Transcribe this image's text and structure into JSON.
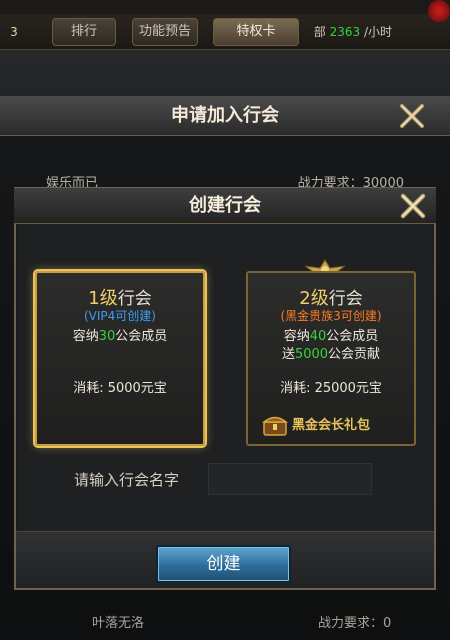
{
  "topbar": {
    "left_badge": "3",
    "tabs": [
      "排行",
      "功能预告",
      "特权卡"
    ],
    "rate_prefix": "部",
    "rate_value": "2363",
    "rate_suffix": "/小时"
  },
  "back_panel": {
    "title": "申请加入行会",
    "rows": [
      {
        "name": "娱乐而已",
        "req_label": "战力要求：",
        "req_value": "30000"
      }
    ],
    "bottom_row": {
      "name": "叶落无洛",
      "req_label": "战力要求：",
      "req_value": "0"
    }
  },
  "dialog": {
    "title": "创建行会",
    "cards": [
      {
        "level": "1级",
        "label": "行会",
        "sub": "(VIP4可创建)",
        "sub_color": "#3a9cf2",
        "capacity_prefix": "容纳",
        "capacity_value": "30",
        "capacity_suffix": "公会成员",
        "extra_prefix": "",
        "extra_value": "",
        "extra_suffix": "",
        "cost": "消耗: 5000元宝",
        "selected": true
      },
      {
        "level": "2级",
        "label": "行会",
        "sub": "(黑金贵族3可创建)",
        "sub_color": "#ff7b24",
        "capacity_prefix": "容纳",
        "capacity_value": "40",
        "capacity_suffix": "公会成员",
        "extra_prefix": "送",
        "extra_value": "5000",
        "extra_suffix": "公会贡献",
        "cost": "消耗: 25000元宝",
        "gift": "黑金会长礼包",
        "selected": false
      }
    ],
    "name_label": "请输入行会名字",
    "name_value": "",
    "name_placeholder": "",
    "create_label": "创建"
  },
  "colors": {
    "accent_gold": "#e6c35a",
    "highlight_green": "#39d33c",
    "button_blue": "#2b6e9a"
  }
}
